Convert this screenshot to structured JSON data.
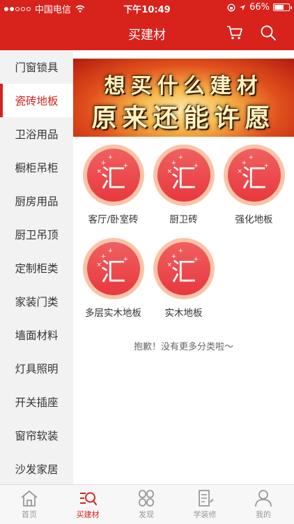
{
  "status": {
    "carrier": "中国电信",
    "time": "下午10:49",
    "battery": "66%",
    "battery_level": 0.66
  },
  "navbar": {
    "title": "买建材"
  },
  "sidebar": {
    "items": [
      {
        "label": "门窗锁具",
        "active": false
      },
      {
        "label": "瓷砖地板",
        "active": true
      },
      {
        "label": "卫浴用品",
        "active": false
      },
      {
        "label": "橱柜吊柜",
        "active": false
      },
      {
        "label": "厨房用品",
        "active": false
      },
      {
        "label": "厨卫吊顶",
        "active": false
      },
      {
        "label": "定制柜类",
        "active": false
      },
      {
        "label": "家装门类",
        "active": false
      },
      {
        "label": "墙面材料",
        "active": false
      },
      {
        "label": "灯具照明",
        "active": false
      },
      {
        "label": "开关插座",
        "active": false
      },
      {
        "label": "窗帘软装",
        "active": false
      },
      {
        "label": "沙发家居",
        "active": false
      }
    ]
  },
  "banner": {
    "line1": "想买什么建材",
    "line2": "原来还能许愿"
  },
  "categories": [
    {
      "label": "客厅/卧室砖",
      "icon_glyph": "汇"
    },
    {
      "label": "厨卫砖",
      "icon_glyph": "汇"
    },
    {
      "label": "强化地板",
      "icon_glyph": "汇"
    },
    {
      "label": "多层实木地板",
      "icon_glyph": "汇"
    },
    {
      "label": "实木地板",
      "icon_glyph": "汇"
    }
  ],
  "end_note": "抱歉！没有更多分类啦～",
  "tabbar": {
    "items": [
      {
        "label": "首页",
        "icon": "home-icon",
        "active": false
      },
      {
        "label": "买建材",
        "icon": "list-search-icon",
        "active": true
      },
      {
        "label": "发现",
        "icon": "discover-icon",
        "active": false
      },
      {
        "label": "学装修",
        "icon": "document-icon",
        "active": false
      },
      {
        "label": "我的",
        "icon": "person-icon",
        "active": false
      }
    ]
  },
  "colors": {
    "primary": "#d8221c",
    "sidebar_bg": "#f2f2f2",
    "tab_inactive": "#999999"
  }
}
